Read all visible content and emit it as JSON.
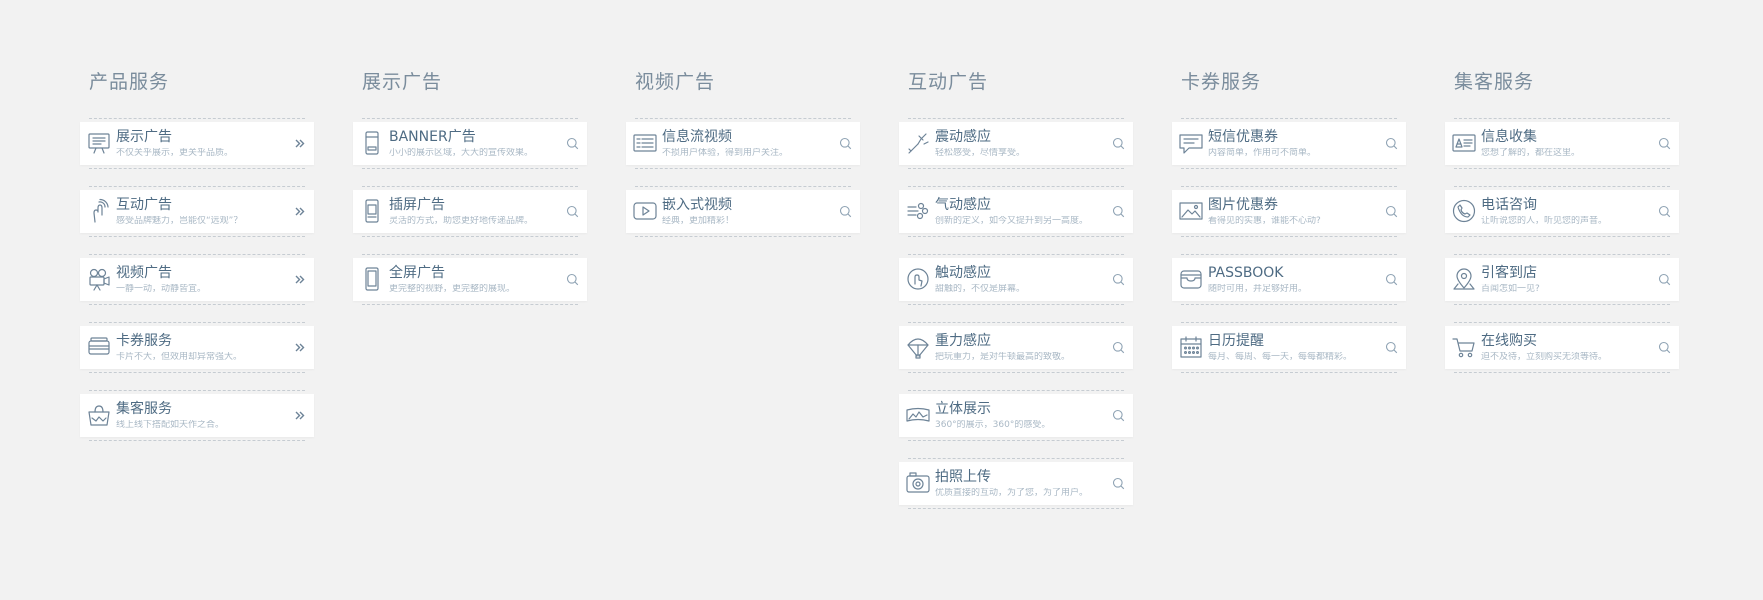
{
  "colors": {
    "background": "#f2f2f2",
    "card": "#ffffff",
    "title_text": "#4e6b83",
    "subtitle_text": "#a9b8c5",
    "column_title": "#7a8c9c",
    "icon_stroke": "#6d8397",
    "dash": "#c6ccd2"
  },
  "columns": [
    {
      "title": "产品服务",
      "action_icon": "double-chevron-right-icon",
      "items": [
        {
          "icon": "display-board-icon",
          "title": "展示广告",
          "subtitle": "不仅关乎展示，更关乎品质。"
        },
        {
          "icon": "touch-hand-icon",
          "title": "互动广告",
          "subtitle": "感受品牌魅力，岂能仅“远观”？"
        },
        {
          "icon": "video-camera-icon",
          "title": "视频广告",
          "subtitle": "一静一动，动静皆宜。"
        },
        {
          "icon": "coupon-card-icon",
          "title": "卡券服务",
          "subtitle": "卡片不大，但效用却异常强大。"
        },
        {
          "icon": "shopping-bag-icon",
          "title": "集客服务",
          "subtitle": "线上线下搭配如天作之合。"
        }
      ]
    },
    {
      "title": "展示广告",
      "action_icon": "search-icon",
      "items": [
        {
          "icon": "phone-banner-icon",
          "title": "BANNER广告",
          "subtitle": "小小的展示区域，大大的宣传效果。"
        },
        {
          "icon": "phone-interstitial-icon",
          "title": "插屏广告",
          "subtitle": "灵活的方式，助您更好地传递品牌。"
        },
        {
          "icon": "phone-fullscreen-icon",
          "title": "全屏广告",
          "subtitle": "更完整的视野，更完整的展现。"
        }
      ]
    },
    {
      "title": "视频广告",
      "action_icon": "search-icon",
      "items": [
        {
          "icon": "feed-list-icon",
          "title": "信息流视频",
          "subtitle": "不损用户体验，得到用户关注。"
        },
        {
          "icon": "play-button-icon",
          "title": "嵌入式视频",
          "subtitle": "经典，更加精彩！"
        }
      ]
    },
    {
      "title": "互动广告",
      "action_icon": "search-icon",
      "items": [
        {
          "icon": "shake-icon",
          "title": "震动感应",
          "subtitle": "轻松感受，尽情享受。"
        },
        {
          "icon": "air-blow-icon",
          "title": "气动感应",
          "subtitle": "创新的定义，如今又提升到另一高度。"
        },
        {
          "icon": "touch-circle-icon",
          "title": "触动感应",
          "subtitle": "甜触的，不仅是屏幕。"
        },
        {
          "icon": "parachute-icon",
          "title": "重力感应",
          "subtitle": "把玩重力，是对牛顿最高的致敬。"
        },
        {
          "icon": "panorama-icon",
          "title": "立体展示",
          "subtitle": "360°的展示，360°的感受。"
        },
        {
          "icon": "camera-icon",
          "title": "拍照上传",
          "subtitle": "优质直接的互动，为了您，为了用户。"
        }
      ]
    },
    {
      "title": "卡券服务",
      "action_icon": "search-icon",
      "items": [
        {
          "icon": "sms-message-icon",
          "title": "短信优惠券",
          "subtitle": "内容简单，作用可不简单。"
        },
        {
          "icon": "image-icon",
          "title": "图片优惠券",
          "subtitle": "看得见的实惠，谁能不心动?"
        },
        {
          "icon": "passbook-wallet-icon",
          "title": "PASSBOOK",
          "subtitle": "随时可用，并足够好用。"
        },
        {
          "icon": "calendar-icon",
          "title": "日历提醒",
          "subtitle": "每月、每周、每一天，每每都精彩。"
        }
      ]
    },
    {
      "title": "集客服务",
      "action_icon": "search-icon",
      "items": [
        {
          "icon": "id-card-icon",
          "title": "信息收集",
          "subtitle": "您想了解的，都在这里。"
        },
        {
          "icon": "phone-call-icon",
          "title": "电话咨询",
          "subtitle": "让听说您的人，听见您的声音。"
        },
        {
          "icon": "location-pin-icon",
          "title": "引客到店",
          "subtitle": "百闻怎如一见?"
        },
        {
          "icon": "shopping-cart-icon",
          "title": "在线购买",
          "subtitle": "迫不及待，立刻购买无须等待。"
        }
      ]
    }
  ]
}
